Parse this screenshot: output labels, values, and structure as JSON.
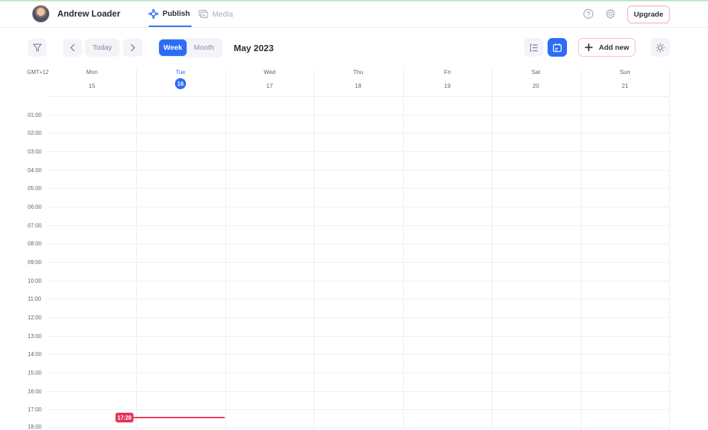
{
  "header": {
    "user_name": "Andrew Loader",
    "tabs": [
      {
        "label": "Publish",
        "active": true
      },
      {
        "label": "Media",
        "active": false
      }
    ],
    "help_icon": "question-circle-icon",
    "settings_icon": "gear-icon",
    "upgrade_label": "Upgrade"
  },
  "toolbar": {
    "filter_icon": "filter-icon",
    "prev_icon": "chevron-left-icon",
    "today_label": "Today",
    "next_icon": "chevron-right-icon",
    "view_modes": [
      {
        "label": "Week",
        "active": true
      },
      {
        "label": "Month",
        "active": false
      }
    ],
    "period_title": "May 2023",
    "list_view_icon": "list-view-icon",
    "calendar_view_icon": "calendar-view-icon",
    "add_new_label": "Add new",
    "theme_icon": "sun-icon"
  },
  "calendar": {
    "timezone": "GMT+12",
    "days": [
      {
        "name": "Mon",
        "date": "15"
      },
      {
        "name": "Tue",
        "date": "16",
        "today": true
      },
      {
        "name": "Wed",
        "date": "17"
      },
      {
        "name": "Thu",
        "date": "18"
      },
      {
        "name": "Fri",
        "date": "19"
      },
      {
        "name": "Sat",
        "date": "20"
      },
      {
        "name": "Sun",
        "date": "21"
      }
    ],
    "hours": [
      "01:00",
      "02:00",
      "03:00",
      "04:00",
      "05:00",
      "06:00",
      "07:00",
      "08:00",
      "09:00",
      "10:00",
      "11:00",
      "12:00",
      "13:00",
      "14:00",
      "15:00",
      "16:00",
      "17:00",
      "18:00"
    ],
    "current_time": "17:28"
  },
  "colors": {
    "accent": "#2d6df6",
    "now_indicator": "#e8335a",
    "upgrade_border": "#f4b9c6"
  }
}
